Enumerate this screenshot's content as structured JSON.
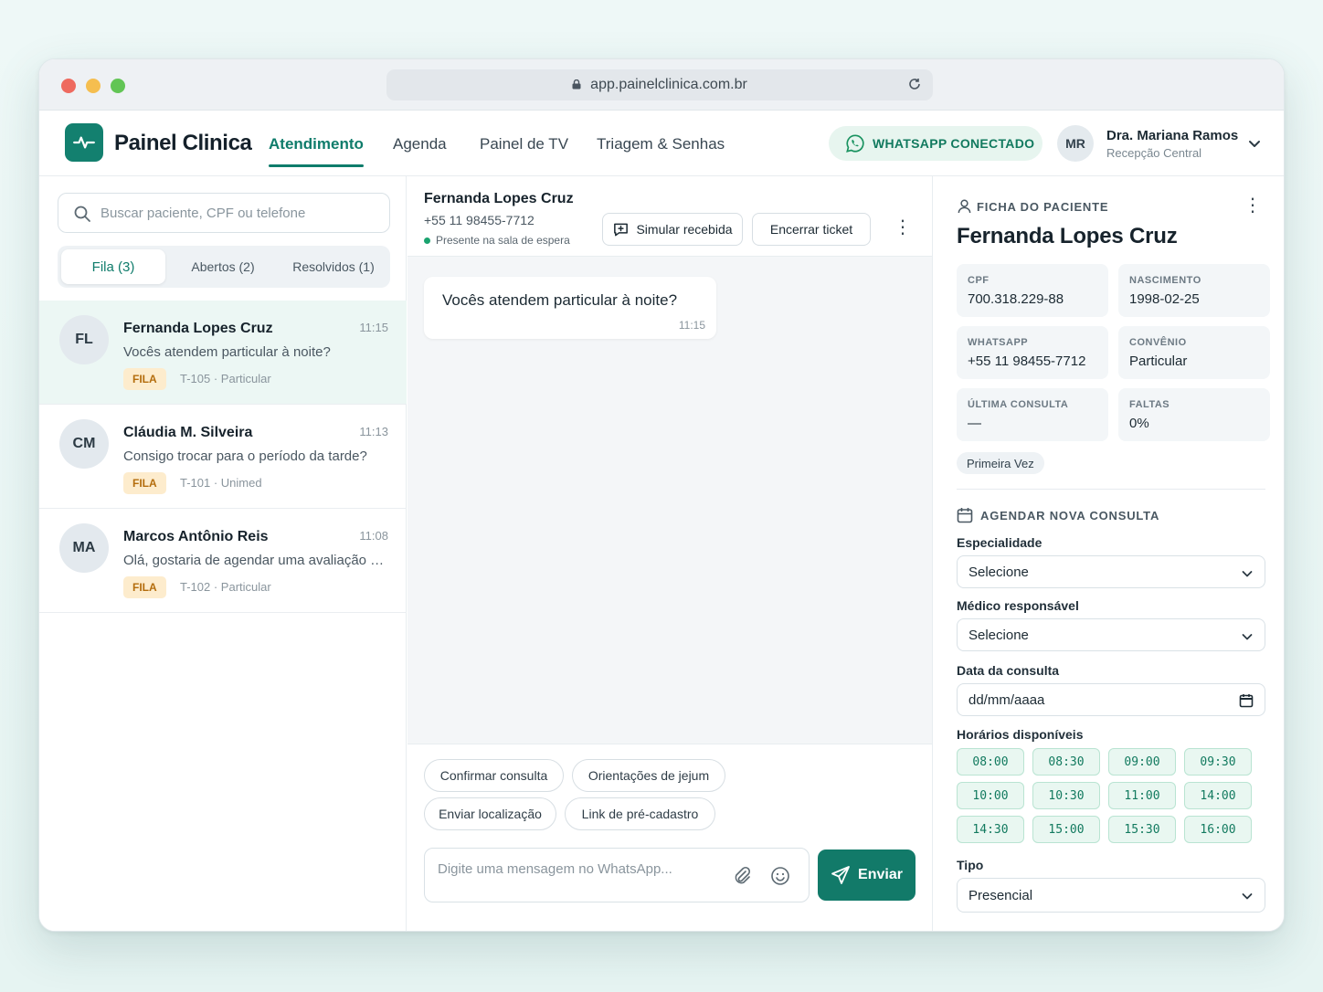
{
  "browser": {
    "url": "app.painelclinica.com.br"
  },
  "app": {
    "brand": "Painel Clinica",
    "nav": [
      "Atendimento",
      "Agenda",
      "Painel de TV",
      "Triagem & Senhas"
    ],
    "whatsapp_status": "WHATSAPP CONECTADO",
    "user": {
      "initials": "MR",
      "name": "Dra. Mariana Ramos",
      "role": "Recepção Central"
    }
  },
  "inbox": {
    "search_placeholder": "Buscar paciente, CPF ou telefone",
    "tabs": [
      "Fila (3)",
      "Abertos (2)",
      "Resolvidos (1)"
    ],
    "conversations": [
      {
        "initials": "FL",
        "name": "Fernanda Lopes Cruz",
        "time": "11:15",
        "message": "Vocês atendem particular à noite?",
        "badge": "FILA",
        "meta": "T-105 · Particular"
      },
      {
        "initials": "CM",
        "name": "Cláudia M. Silveira",
        "time": "11:13",
        "message": "Consigo trocar para o período da tarde?",
        "badge": "FILA",
        "meta": "T-101 · Unimed"
      },
      {
        "initials": "MA",
        "name": "Marcos Antônio Reis",
        "time": "11:08",
        "message": "Olá, gostaria de agendar uma avaliação co...",
        "badge": "FILA",
        "meta": "T-102 · Particular"
      }
    ]
  },
  "chat": {
    "name": "Fernanda Lopes Cruz",
    "phone": "+55 11 98455-7712",
    "status": "Presente na sala de espera",
    "simulate_label": "Simular recebida",
    "close_label": "Encerrar ticket",
    "messages": [
      {
        "text": "Vocês atendem particular à noite?",
        "time": "11:15"
      }
    ],
    "quick_replies": [
      "Confirmar consulta",
      "Orientações de jejum",
      "Enviar localização",
      "Link de pré-cadastro"
    ],
    "composer_placeholder": "Digite uma mensagem no WhatsApp...",
    "send_label": "Enviar"
  },
  "patient": {
    "section_title": "FICHA DO PACIENTE",
    "name": "Fernanda Lopes Cruz",
    "fields": [
      {
        "label": "CPF",
        "value": "700.318.229-88"
      },
      {
        "label": "NASCIMENTO",
        "value": "1998-02-25"
      },
      {
        "label": "WHATSAPP",
        "value": "+55 11 98455-7712"
      },
      {
        "label": "CONVÊNIO",
        "value": "Particular"
      },
      {
        "label": "ÚLTIMA CONSULTA",
        "value": "—"
      },
      {
        "label": "FALTAS",
        "value": "0%"
      }
    ],
    "tag": "Primeira Vez"
  },
  "schedule": {
    "section_title": "AGENDAR NOVA CONSULTA",
    "specialty_label": "Especialidade",
    "specialty_value": "Selecione",
    "doctor_label": "Médico responsável",
    "doctor_value": "Selecione",
    "date_label": "Data da consulta",
    "date_value": "dd/mm/aaaa",
    "slots_label": "Horários disponíveis",
    "slots": [
      "08:00",
      "08:30",
      "09:00",
      "09:30",
      "10:00",
      "10:30",
      "11:00",
      "14:00",
      "14:30",
      "15:00",
      "15:30",
      "16:00"
    ],
    "type_label": "Tipo",
    "type_value": "Presencial"
  }
}
